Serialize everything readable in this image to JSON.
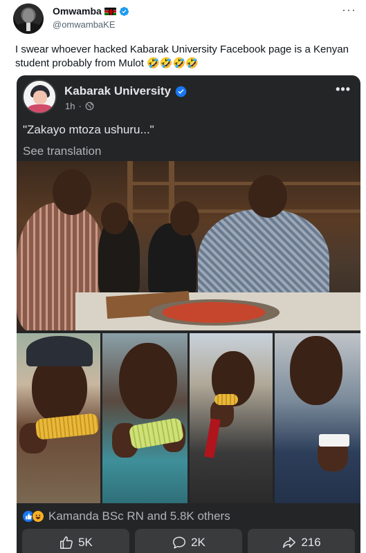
{
  "tweet": {
    "author_name": "Omwamba",
    "author_handle": "@omwambaKE",
    "more_label": "···",
    "text": "I swear whoever hacked Kabarak University Facebook page is a Kenyan student probably from Mulot 🤣🤣🤣🤣"
  },
  "facebook_post": {
    "page_name": "Kabarak University",
    "time": "1h",
    "separator": "·",
    "more_label": "•••",
    "text": "\"Zakayo mtoza ushuru...\"",
    "see_translation": "See translation",
    "reactions_text": "Kamanda BSc RN and 5.8K others",
    "actions": {
      "like": "5K",
      "comment": "2K",
      "share": "216"
    }
  },
  "colors": {
    "verified": "#1d9bf0",
    "fb_card": "#242526",
    "fb_text": "#e4e6eb",
    "fb_muted": "#b0b3b8",
    "like_blue": "#1877f2"
  },
  "icons": [
    "verified-badge-icon",
    "kenya-flag-icon",
    "globe-icon",
    "like-icon",
    "comment-icon",
    "share-icon",
    "haha-reaction-icon"
  ]
}
